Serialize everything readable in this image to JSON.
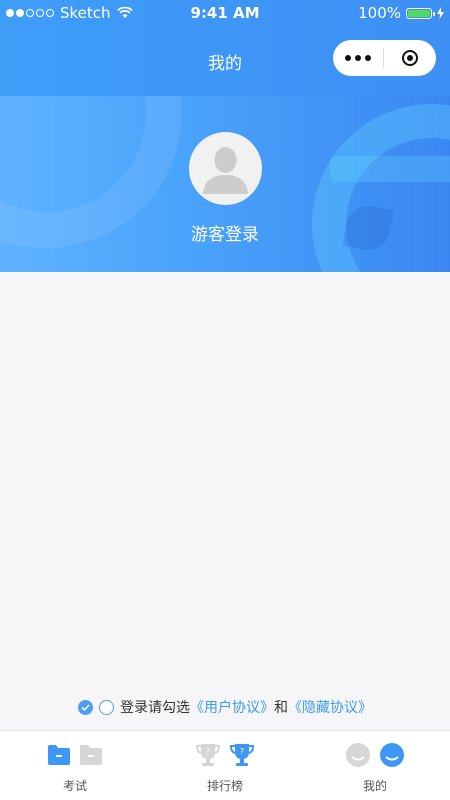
{
  "status_bar": {
    "carrier": "Sketch",
    "time": "9:41 AM",
    "battery": "100%"
  },
  "nav": {
    "title": "我的"
  },
  "profile": {
    "login_text": "游客登录"
  },
  "agreement": {
    "prefix": "登录请勾选",
    "user_agreement": "《用户协议》",
    "joiner": "和",
    "privacy_agreement": "《隐藏协议》"
  },
  "tabbar": {
    "items": [
      {
        "label": "考试"
      },
      {
        "label": "排行榜"
      },
      {
        "label": "我的"
      }
    ]
  },
  "colors": {
    "primary": "#3d8ff4",
    "link": "#3a9cf0",
    "battery": "#4cd964"
  }
}
